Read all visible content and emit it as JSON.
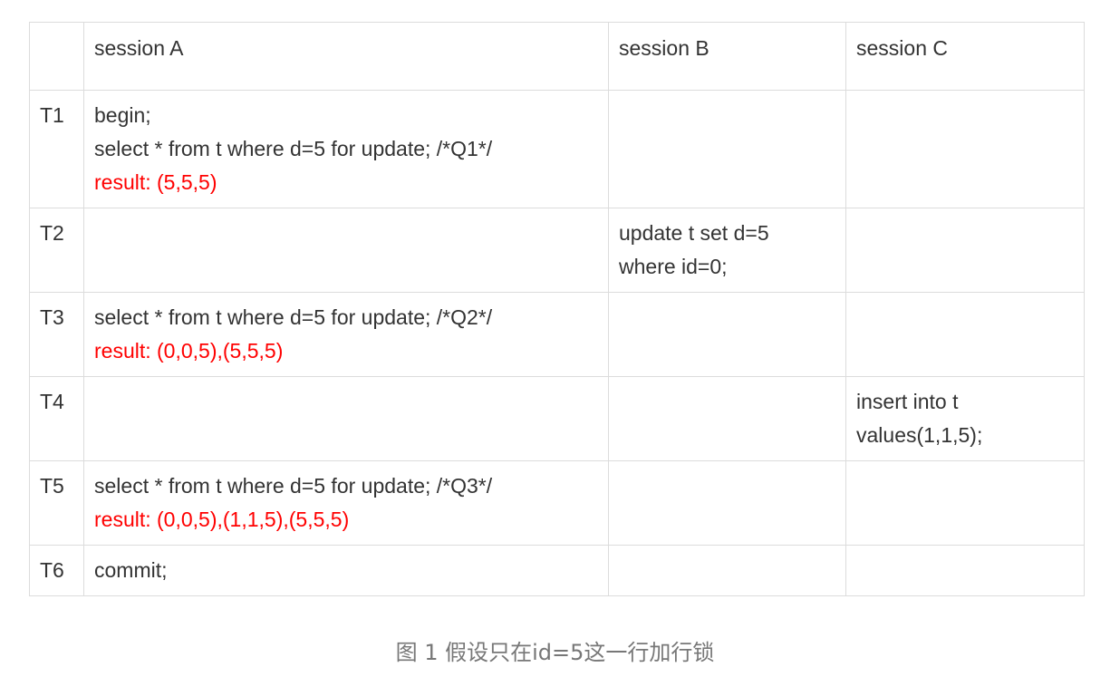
{
  "table": {
    "headers": [
      "",
      "session A",
      "session B",
      "session C"
    ],
    "rows": [
      {
        "time": "T1",
        "a": [
          "begin;",
          "select * from t where d=5 for update; /*Q1*/"
        ],
        "a_result": "result: (5,5,5)",
        "b": [],
        "c": []
      },
      {
        "time": "T2",
        "a": [],
        "a_result": "",
        "b": [
          "update t set d=5",
          "where id=0;"
        ],
        "c": []
      },
      {
        "time": "T3",
        "a": [
          "select * from t where d=5 for update; /*Q2*/"
        ],
        "a_result": "result: (0,0,5),(5,5,5)",
        "b": [],
        "c": []
      },
      {
        "time": "T4",
        "a": [],
        "a_result": "",
        "b": [],
        "c": [
          "insert into t",
          "values(1,1,5);"
        ]
      },
      {
        "time": "T5",
        "a": [
          "select * from t where d=5 for update; /*Q3*/"
        ],
        "a_result": "result: (0,0,5),(1,1,5),(5,5,5)",
        "b": [],
        "c": []
      },
      {
        "time": "T6",
        "a": [
          "commit;"
        ],
        "a_result": "",
        "b": [],
        "c": []
      }
    ]
  },
  "caption": "图 1 假设只在id=5这一行加行锁",
  "colors": {
    "result_text": "#ff0000",
    "body_text": "#333333",
    "caption_text": "#777777",
    "border": "#dcdcdc"
  }
}
